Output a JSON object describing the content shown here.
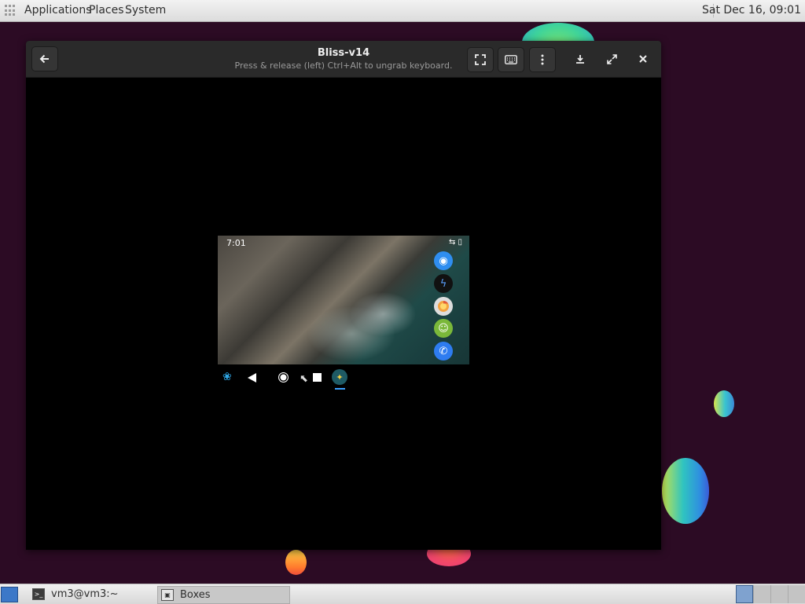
{
  "top_panel": {
    "menus": [
      "Applications",
      "Places",
      "System"
    ],
    "clock": "Sat Dec 16, 09:01"
  },
  "window": {
    "title": "Bliss-v14",
    "subtitle": "Press & release (left) Ctrl+Alt to ungrab keyboard."
  },
  "android": {
    "time": "7:01",
    "dock_apps": [
      "camera-icon",
      "flash-icon",
      "browser-icon",
      "messages-icon",
      "phone-icon"
    ]
  },
  "taskbar": {
    "tasks": [
      {
        "label": "vm3@vm3:~",
        "icon": "terminal-icon"
      },
      {
        "label": "Boxes",
        "icon": "boxes-icon"
      }
    ],
    "workspaces": 4
  }
}
